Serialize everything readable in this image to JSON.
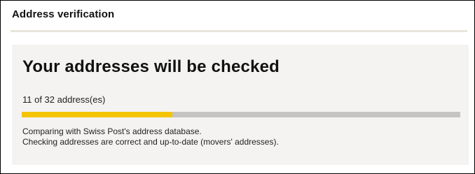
{
  "dialog": {
    "title": "Address verification"
  },
  "panel": {
    "heading": "Your addresses will be checked",
    "progress": {
      "label": "11 of 32 address(es)",
      "current": 11,
      "total": 32,
      "fill_fraction": 0.34375
    },
    "status_lines": [
      "Comparing with Swiss Post's address database.",
      "Checking addresses are correct and up-to-date (movers' addresses)."
    ]
  },
  "colors": {
    "progress_fill": "#f5c400",
    "progress_track": "#c4c4c4",
    "panel_background": "#f4f3f1",
    "title_rule": "#e8e5dc"
  }
}
